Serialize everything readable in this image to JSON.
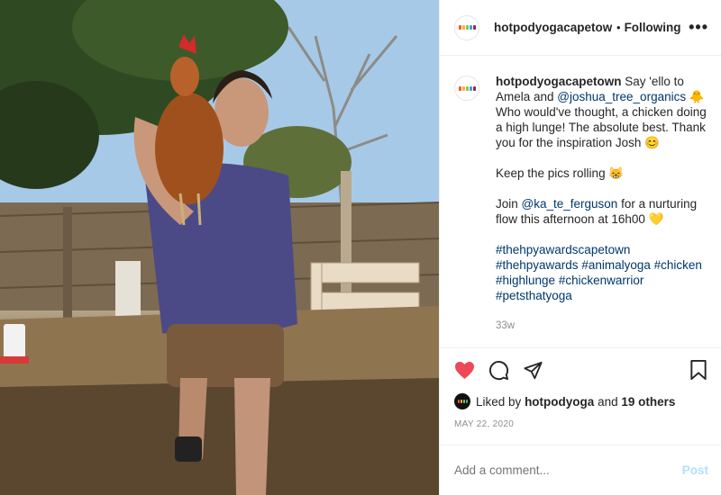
{
  "photo": {
    "alt_subject": "person-holding-chicken"
  },
  "header": {
    "username": "hotpodyogacapetown",
    "dot": "•",
    "follow_state": "Following",
    "more": "•••"
  },
  "caption": {
    "username": "hotpodyogacapetown",
    "line1_pre": "Say 'ello to Amela and ",
    "mention1": "@joshua_tree_organics",
    "line1_post": " 🐥 Who would've thought, a chicken doing a high lunge! The absolute best. Thank you for the inspiration Josh 😊",
    "para2": "Keep the pics rolling 😸",
    "para3_pre": "Join ",
    "mention2": "@ka_te_ferguson",
    "para3_post": " for a nurturing flow this afternoon at 16h00 💛",
    "hashtags": [
      "#thehpyawardscapetown",
      "#thehpyawards",
      "#animalyoga",
      "#chicken",
      "#highlunge",
      "#chickenwarrior",
      "#petsthatyoga"
    ],
    "time_ago": "33w"
  },
  "actions": {
    "like_icon": "heart-icon",
    "comment_icon": "comment-icon",
    "share_icon": "share-icon",
    "save_icon": "bookmark-icon",
    "liked_color": "#ed4956"
  },
  "likes": {
    "prefix": "Liked by",
    "user": "hotpodyoga",
    "and": "and",
    "others": "19 others"
  },
  "date": "MAY 22, 2020",
  "comment_box": {
    "placeholder": "Add a comment...",
    "post_label": "Post"
  },
  "colors": {
    "link": "#00376b",
    "post_disabled": "#b2dffc",
    "muted": "#8e8e8e"
  }
}
